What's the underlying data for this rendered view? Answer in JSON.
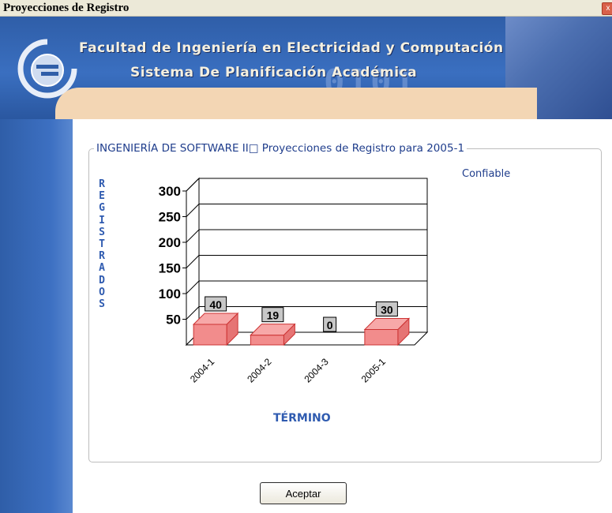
{
  "window": {
    "title": "Proyecciones de Registro",
    "close_glyph": "x"
  },
  "banner": {
    "line1": "Facultad de Ingeniería en Electricidad y Computación",
    "line2": "Sistema De Planificación Académica",
    "logo_icon": "globe-logo-icon"
  },
  "panel": {
    "legend": "INGENIERÍA DE SOFTWARE II□ Proyecciones de Registro para 2005-1",
    "reliability": "Confiable"
  },
  "chart_data": {
    "type": "bar",
    "title": "",
    "ylabel": "REGISTRADOS",
    "xlabel": "TÉRMINO",
    "categories": [
      "2004-1",
      "2004-2",
      "2004-3",
      "2005-1"
    ],
    "values": [
      40,
      19,
      0,
      30
    ],
    "yticks": [
      50,
      100,
      150,
      200,
      250,
      300
    ],
    "ylim": [
      0,
      300
    ],
    "grid": true,
    "three_d": true,
    "bar_color": "#f28c8c",
    "bar_edge_color": "#cc3333"
  },
  "actions": {
    "accept_label": "Aceptar"
  },
  "colors": {
    "banner_blue": "#2f5ea8",
    "accent_blue": "#1f3d8c",
    "axis_label_blue": "#2f5bb0",
    "band_orange": "#f3d6b4"
  }
}
